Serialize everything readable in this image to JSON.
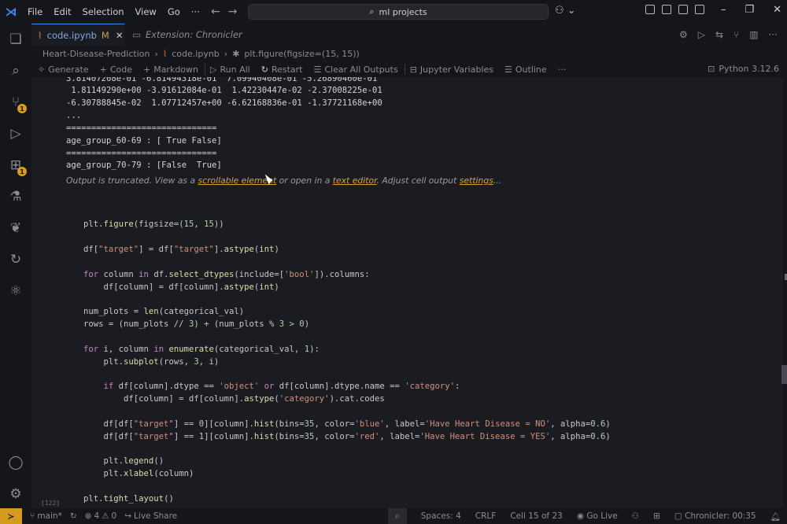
{
  "menu": [
    "File",
    "Edit",
    "Selection",
    "View",
    "Go",
    "···"
  ],
  "command_center": "ml projects",
  "tabs": {
    "active": {
      "label": "code.ipynb",
      "mark": "M",
      "close": "✕"
    },
    "extension": {
      "label": "Extension: Chronicler"
    }
  },
  "breadcrumb": [
    "Heart-Disease-Prediction",
    "code.ipynb",
    "plt.figure(figsize=(15, 15))"
  ],
  "toolbar": {
    "generate": "Generate",
    "code": "Code",
    "markdown": "Markdown",
    "run_all": "Run All",
    "restart": "Restart",
    "clear_all": "Clear All Outputs",
    "variables": "Jupyter Variables",
    "outline": "Outline",
    "more": "···",
    "kernel": "Python 3.12.6"
  },
  "output": {
    "lines": [
      "3.81407208e-01 -6.81494318e-01  7.09940408e-01 -5.26890460e-01",
      " 1.81149290e+00 -3.91612084e-01  1.42230447e-02 -2.37008225e-01",
      "-6.30788845e-02  1.07712457e+00 -6.62168836e-01 -1.37721168e+00",
      "...",
      "==============================",
      "age_group_60-69 : [ True False]",
      "==============================",
      "age_group_70-79 : [False  True]"
    ],
    "truncated": {
      "prefix": "Output is truncated. View as a ",
      "link1": "scrollable element",
      "mid": " or open in a ",
      "link2": "text editor",
      "mid2": ". Adjust cell output ",
      "link3": "settings",
      "suffix": "..."
    }
  },
  "cell": {
    "exec_count": "[122]"
  },
  "status": {
    "branch": "main*",
    "errors": "4",
    "warnings": "0",
    "live_share": "Live Share",
    "spaces": "Spaces: 4",
    "eol": "CRLF",
    "cell": "Cell 15 of 23",
    "go_live": "Go Live",
    "chronicler": "Chronicler: 00:35"
  },
  "colors": {
    "accent": "#3b8eea",
    "warning_badge": "#d59b1f",
    "link": "#d6a330"
  }
}
